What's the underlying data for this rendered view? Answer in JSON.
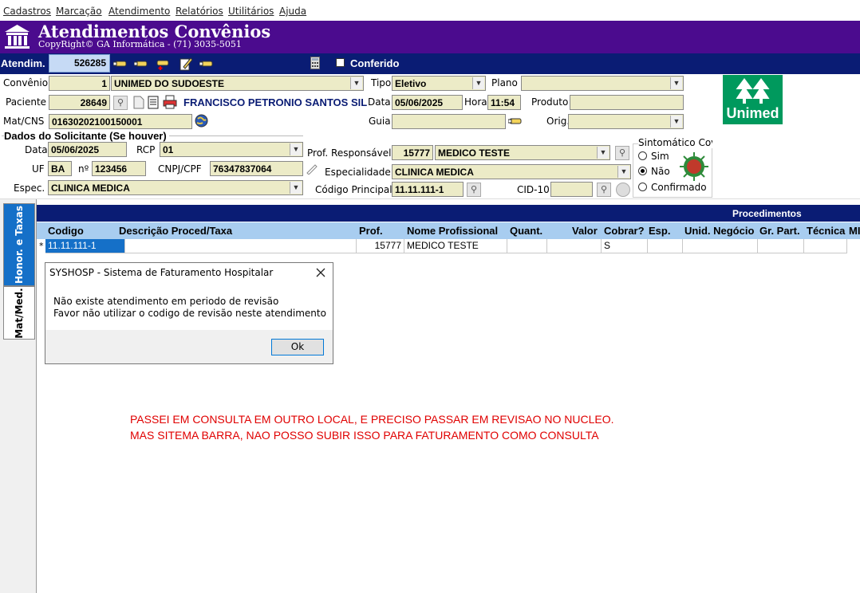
{
  "menu": [
    "Cadastros",
    "Marcação",
    "Atendimento",
    "Relatórios",
    "Utilitários",
    "Ajuda"
  ],
  "header": {
    "title": "Atendimentos Convênios",
    "copyright": "CopyRight© GA Informática - (71) 3035-5051"
  },
  "toolbar": {
    "atendim_label": "Atendim.",
    "atendim_value": "526285",
    "conferido_label": "Conferido"
  },
  "form": {
    "convenio_label": "Convênio",
    "convenio_code": "1",
    "convenio_name": "UNIMED DO SUDOESTE",
    "tipo_label": "Tipo",
    "tipo_value": "Eletivo",
    "plano_label": "Plano",
    "plano_value": "",
    "paciente_label": "Paciente",
    "paciente_code": "28649",
    "paciente_name": "FRANCISCO PETRONIO SANTOS SIL",
    "data_label": "Data",
    "data_value": "05/06/2025",
    "hora_label": "Hora",
    "hora_value": "11:54",
    "produto_label": "Produto",
    "produto_value": "",
    "matcns_label": "Mat/CNS",
    "matcns_value": "01630202100150001",
    "guia_label": "Guia",
    "guia_value": "",
    "orig_label": "Orig.",
    "orig_value": ""
  },
  "solicitante": {
    "section_title": "Dados do Solicitante (Se houver)",
    "data_label": "Data",
    "data_value": "05/06/2025",
    "rcp_label": "RCP",
    "rcp_value": "01",
    "uf_label": "UF",
    "uf_value": "BA",
    "num_label": "nº",
    "num_value": "123456",
    "cnpj_label": "CNPJ/CPF",
    "cnpj_value": "76347837064",
    "espec_label": "Espec.",
    "espec_value": "CLINICA MEDICA"
  },
  "profissional": {
    "prof_label": "Prof. Responsável",
    "prof_code": "15777",
    "prof_name": "MEDICO TESTE",
    "espec_label": "Especialidade",
    "espec_value": "CLINICA MEDICA",
    "codigo_label": "Código Principal",
    "codigo_value": "11.11.111-1",
    "cid_label": "CID-10",
    "cid_value": ""
  },
  "covid": {
    "title": "Sintomático Covid",
    "options": [
      "Sim",
      "Não",
      "Confirmado"
    ],
    "selected": "Não"
  },
  "logo": {
    "text": "Unimed",
    "color": "#00995d"
  },
  "tabs": [
    "Honor. e Taxas",
    "Mat/Med."
  ],
  "grid": {
    "title": "Procedimentos",
    "columns": [
      "Codigo",
      "Descrição Proced/Taxa",
      "Prof.",
      "Nome Profissional",
      "Quant.",
      "Valor",
      "Cobrar?",
      "Esp.",
      "Unid. Negócio",
      "Gr. Part.",
      "Técnica",
      "MI"
    ],
    "row": {
      "marker": "*",
      "codigo": "11.11.111-1",
      "descricao": "",
      "prof": "15777",
      "nome": "MEDICO TESTE",
      "quant": "",
      "valor": "",
      "cobrar": "S",
      "esp": "",
      "unid": "",
      "grpart": "",
      "tecnica": ""
    }
  },
  "dialog": {
    "title": "SYSHOSP - Sistema de Faturamento Hospitalar",
    "line1": "Não existe atendimento em periodo de revisão",
    "line2": "Favor não utilizar o codigo de revisão neste atendimento",
    "ok": "Ok"
  },
  "note": {
    "line1": "PASSEI EM CONSULTA EM OUTRO LOCAL, E PRECISO PASSAR EM REVISAO NO NUCLEO.",
    "line2": "MAS SITEMA BARRA, NAO POSSO SUBIR ISSO PARA FATURAMENTO COMO CONSULTA"
  },
  "colors": {
    "title_bar": "#4b0b8e",
    "blue_bar": "#0a1c74",
    "field_bg": "#ecebc7",
    "grid_header": "#a8cdf0",
    "tab_active": "#1570c8",
    "note_text": "#e00000"
  }
}
